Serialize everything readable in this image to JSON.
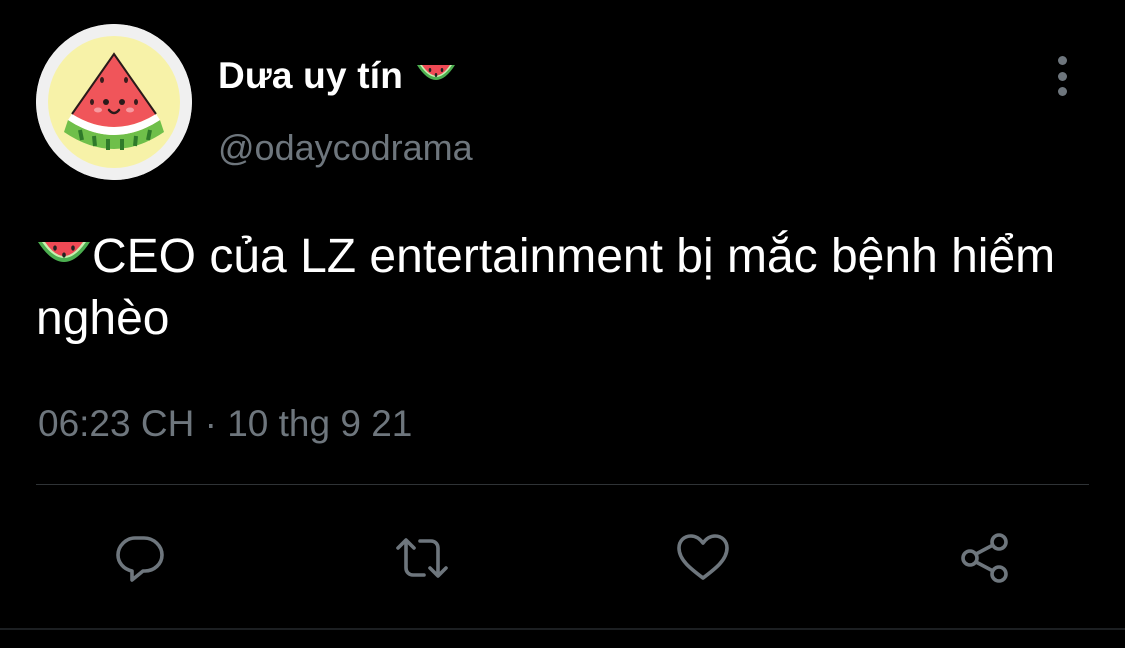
{
  "tweet": {
    "display_name": "Dưa uy tín",
    "name_emoji": "watermelon-emoji",
    "handle": "@odaycodrama",
    "body_emoji": "watermelon-emoji",
    "body_text": "CEO của LZ entertainment bị mắc bệnh hiểm nghèo",
    "timestamp": "06:23 CH · 10 thg 9 21"
  },
  "actions": {
    "reply_icon": "reply-icon",
    "retweet_icon": "retweet-icon",
    "like_icon": "like-icon",
    "share_icon": "share-icon",
    "more_icon": "more-vertical-icon"
  },
  "colors": {
    "background": "#000000",
    "primary_text": "#ffffff",
    "secondary_text": "#6e767d",
    "divider": "#2f3336",
    "icon": "#6e767d"
  }
}
